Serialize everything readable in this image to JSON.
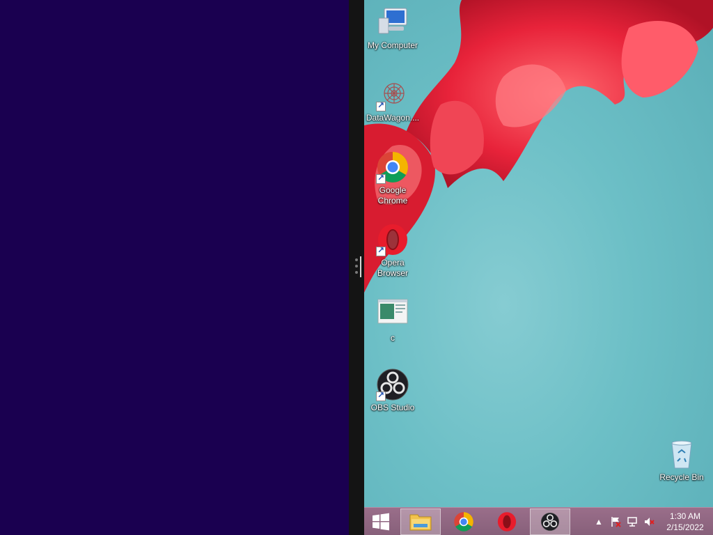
{
  "desktop": {
    "icons": [
      {
        "label": "My Computer",
        "icon": "computer-icon"
      },
      {
        "label": "DataWagon....",
        "icon": "datawagon-icon"
      },
      {
        "label": "Google Chrome",
        "icon": "chrome-icon"
      },
      {
        "label": "Opera Browser",
        "icon": "opera-icon"
      },
      {
        "label": "c",
        "icon": "image-file-icon"
      },
      {
        "label": "OBS Studio",
        "icon": "obs-icon"
      },
      {
        "label": "Recycle Bin",
        "icon": "recycle-bin-icon"
      }
    ]
  },
  "taskbar": {
    "buttons": [
      {
        "name": "start",
        "icon": "windows-logo-icon"
      },
      {
        "name": "file-explorer",
        "icon": "folder-icon",
        "active": true
      },
      {
        "name": "chrome",
        "icon": "chrome-icon"
      },
      {
        "name": "opera",
        "icon": "opera-icon"
      },
      {
        "name": "obs",
        "icon": "obs-icon",
        "active": true
      }
    ],
    "tray": {
      "icons": [
        "show-hidden-icons-chevron",
        "action-center-flag-icon",
        "network-icon",
        "volume-muted-icon"
      ],
      "time": "1:30 AM",
      "date": "2/15/2022"
    }
  },
  "colors": {
    "left_pane": "#1a0050",
    "taskbar": "#8f6683",
    "desktop_sky": "#6cbfc6",
    "flower": "#e8233a"
  }
}
